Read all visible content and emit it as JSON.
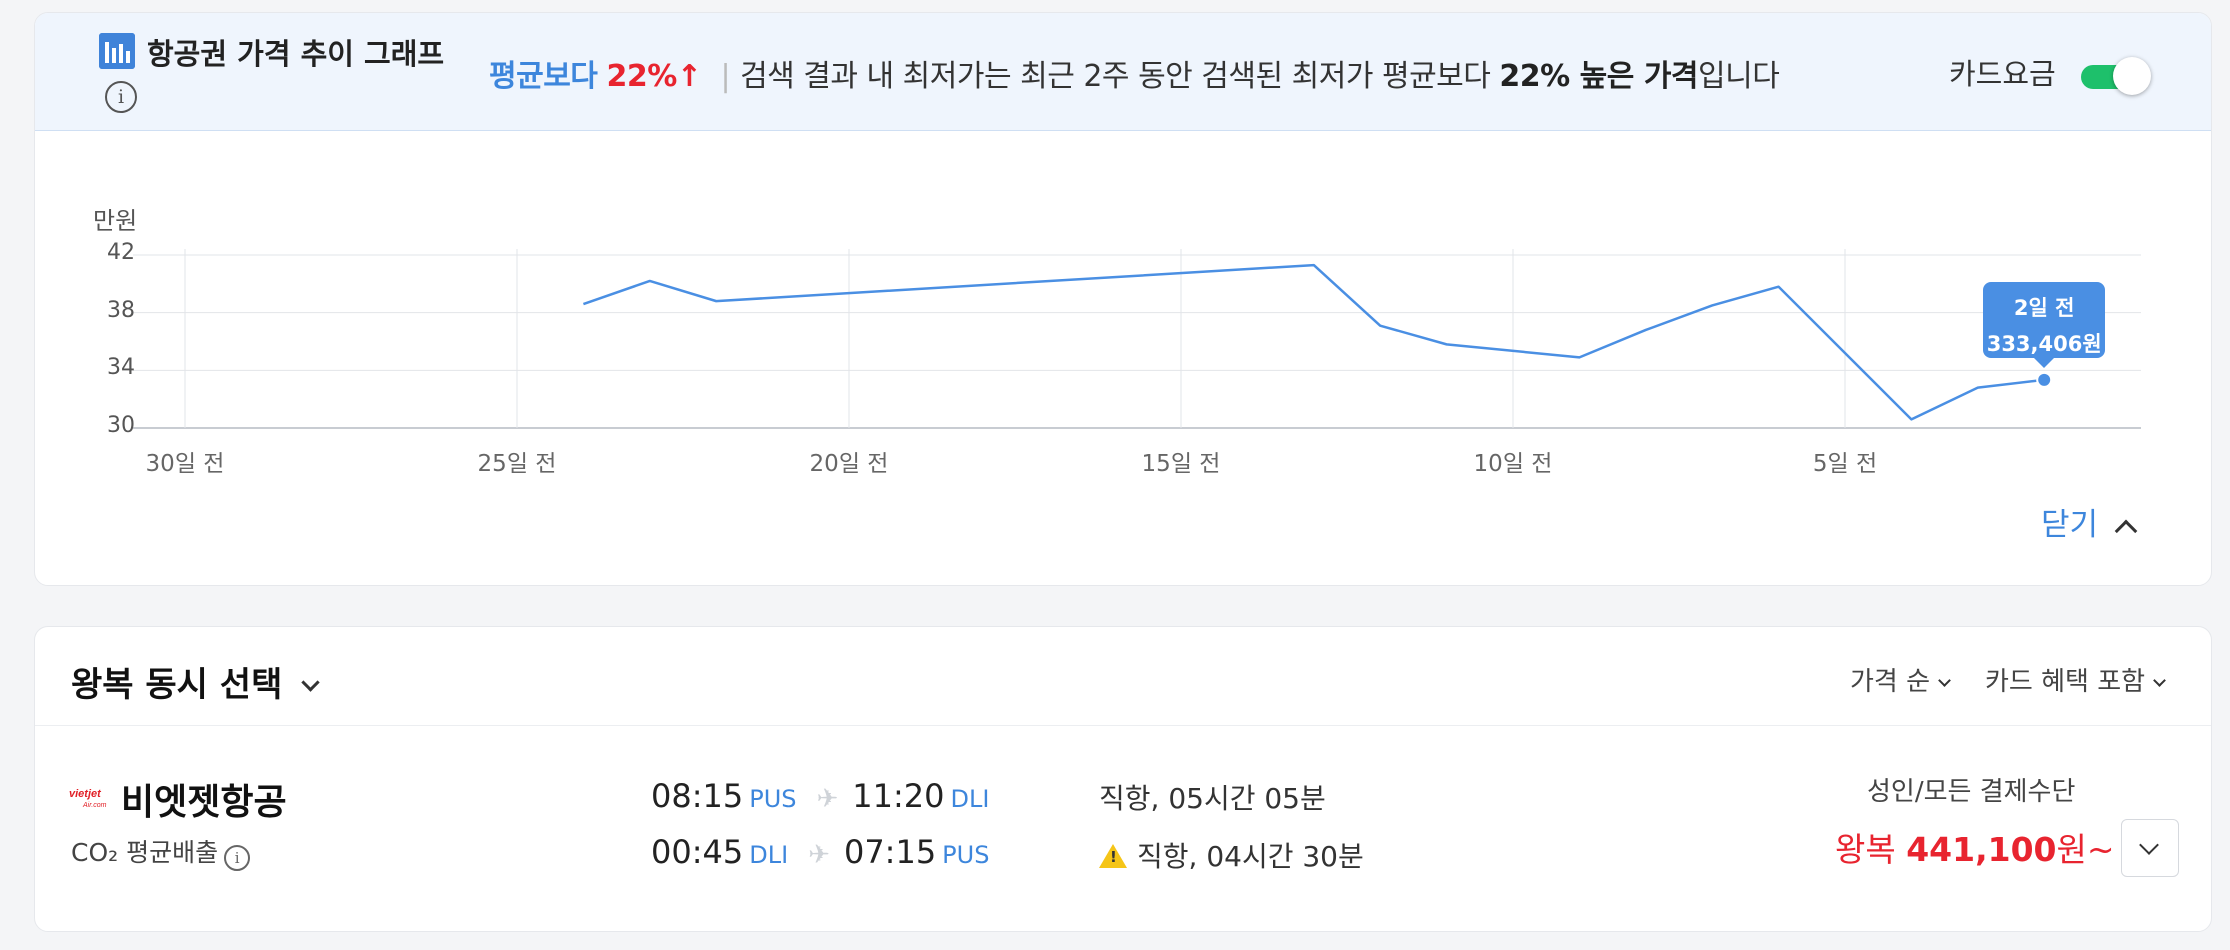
{
  "header": {
    "title": "항공권 가격 추이 그래프",
    "summary_avg_label": "평균보다",
    "summary_pct": "22%",
    "summary_arrow": "↑",
    "summary_separator": "|",
    "summary_text_pre": "검색 결과 내 최저가는 최근 2주 동안 검색된 최저가 평균보다 ",
    "summary_bold": "22% 높은 가격",
    "summary_text_post": "입니다",
    "card_fare_label": "카드요금",
    "card_fare_enabled": true,
    "icons": {
      "chart": "bar-chart-icon",
      "info": "info-icon"
    }
  },
  "chart_data": {
    "type": "line",
    "ylabel": "만원",
    "ylim": [
      30,
      42
    ],
    "yticks": [
      "42",
      "38",
      "34",
      "30"
    ],
    "xticks": [
      "30일 전",
      "25일 전",
      "20일 전",
      "15일 전",
      "10일 전",
      "5일 전"
    ],
    "grid": true,
    "series": [
      {
        "x": [
          -24,
          -23,
          -22,
          -13,
          -12,
          -11,
          -9,
          -8,
          -7,
          -6,
          -4,
          -3,
          -2
        ],
        "values": [
          38.6,
          40.2,
          38.8,
          41.3,
          37.1,
          35.8,
          34.9,
          36.8,
          38.5,
          39.8,
          30.6,
          32.8,
          33.34
        ],
        "color": "#4a8fe3"
      }
    ],
    "highlight": {
      "x": -2,
      "label": "2일 전",
      "value_label": "333,406원"
    },
    "close_label": "닫기"
  },
  "results": {
    "section_title": "왕복 동시 선택",
    "sort_label": "가격 순",
    "benefit_label": "카드 혜택 포함",
    "flight": {
      "airline": "비엣젯항공",
      "logo_text": "vietjet",
      "co2_label": "CO₂ 평균배출",
      "legs": [
        {
          "depart_time": "08:15",
          "depart_apt": "PUS",
          "arrive_time": "11:20",
          "arrive_apt": "DLI",
          "info": "직항, 05시간 05분",
          "warning": false
        },
        {
          "depart_time": "00:45",
          "depart_apt": "DLI",
          "arrive_time": "07:15",
          "arrive_apt": "PUS",
          "info": "직항, 04시간 30분",
          "warning": true
        }
      ],
      "payment_label": "성인/모든 결제수단",
      "price_prefix": "왕복 ",
      "price_value": "441,100",
      "price_suffix": "원~"
    }
  },
  "colors": {
    "accent": "#3d86dc",
    "red": "#e8242f",
    "toggle_on": "#1ec06b",
    "line": "#4a8fe3"
  }
}
